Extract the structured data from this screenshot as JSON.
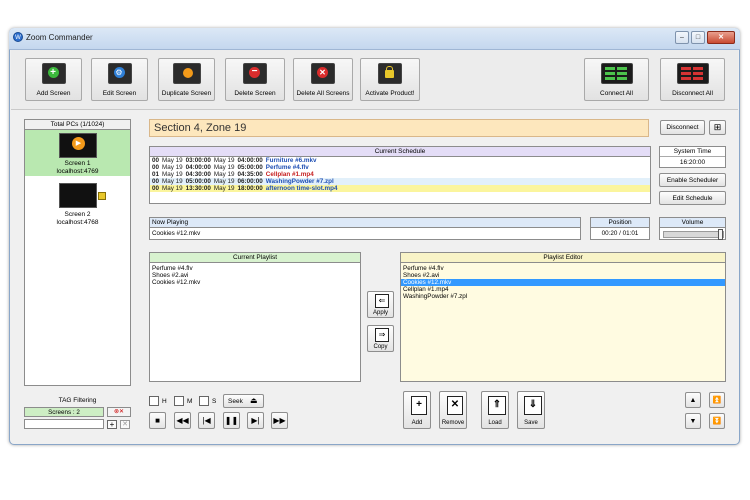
{
  "window": {
    "title": "Zoom Commander",
    "app_icon": "W"
  },
  "toolbar": {
    "add_screen": "Add Screen",
    "edit_screen": "Edit Screen",
    "duplicate_screen": "Duplicate Screen",
    "delete_screen": "Delete Screen",
    "delete_all_screens": "Delete All Screens",
    "activate_product": "Activate Product!",
    "connect_all": "Connect All",
    "disconnect_all": "Disconnect All"
  },
  "pcs": {
    "header": "Total PCs (1/1024)",
    "screens": [
      {
        "name": "Screen 1",
        "host": "localhost:4769"
      },
      {
        "name": "Screen 2",
        "host": "localhost:4768"
      }
    ]
  },
  "section_title": "Section 4, Zone 19",
  "disconnect_label": "Disconnect",
  "schedule": {
    "header": "Current Schedule",
    "rows": [
      {
        "ch": "00",
        "d1": "May 19",
        "t1": "03:00:00",
        "d2": "May 19",
        "t2": "04:00:00",
        "file": "Furniture #6.mkv",
        "color": "blue"
      },
      {
        "ch": "00",
        "d1": "May 19",
        "t1": "04:00:00",
        "d2": "May 19",
        "t2": "05:00:00",
        "file": "Perfume #4.flv",
        "color": "blue"
      },
      {
        "ch": "01",
        "d1": "May 19",
        "t1": "04:30:00",
        "d2": "May 19",
        "t2": "04:35:00",
        "file": "Cellplan #1.mp4",
        "color": "red"
      },
      {
        "ch": "00",
        "d1": "May 19",
        "t1": "05:00:00",
        "d2": "May 19",
        "t2": "06:00:00",
        "file": "WashingPowder #7.zpl",
        "color": "blue"
      },
      {
        "ch": "00",
        "d1": "May 19",
        "t1": "13:30:00",
        "d2": "May 19",
        "t2": "18:00:00",
        "file": "afternoon time-slot.mp4",
        "color": "blue"
      }
    ]
  },
  "system_time": {
    "label": "System Time",
    "value": "16:20:00"
  },
  "enable_scheduler": "Enable Scheduler",
  "edit_schedule": "Edit Schedule",
  "now_playing": {
    "label": "Now Playing",
    "value": "Cookies #12.mkv"
  },
  "position": {
    "label": "Position",
    "value": "00:20 / 01:01"
  },
  "volume": {
    "label": "Volume",
    "level": 0.97
  },
  "current_playlist": {
    "header": "Current Playlist",
    "items": [
      "Perfume #4.flv",
      "Shoes #2.avi",
      "Cookies #12.mkv"
    ]
  },
  "playlist_editor": {
    "header": "Playlist Editor",
    "items": [
      "Perfume #4.flv",
      "Shoes #2.avi",
      "Cookies #12.mkv",
      "Cellplan #1.mp4",
      "WashingPowder #7.zpl"
    ],
    "selected_index": 2
  },
  "apply_label": "Apply",
  "copy_label": "Copy",
  "tag_filtering": {
    "label": "TAG Filtering",
    "screens": "Screens : 2"
  },
  "seek": {
    "h": "H",
    "m": "M",
    "s": "S",
    "label": "Seek"
  },
  "editor_buttons": {
    "add": "Add",
    "remove": "Remove",
    "load": "Load",
    "save": "Save"
  },
  "colors": {
    "selected_screen": "#b9e8b0",
    "section_bg": "#fde7bd",
    "schedule_header": "#e4ddf7",
    "selected_row": "#3399ff",
    "highlight_row": "#fbf59d"
  }
}
